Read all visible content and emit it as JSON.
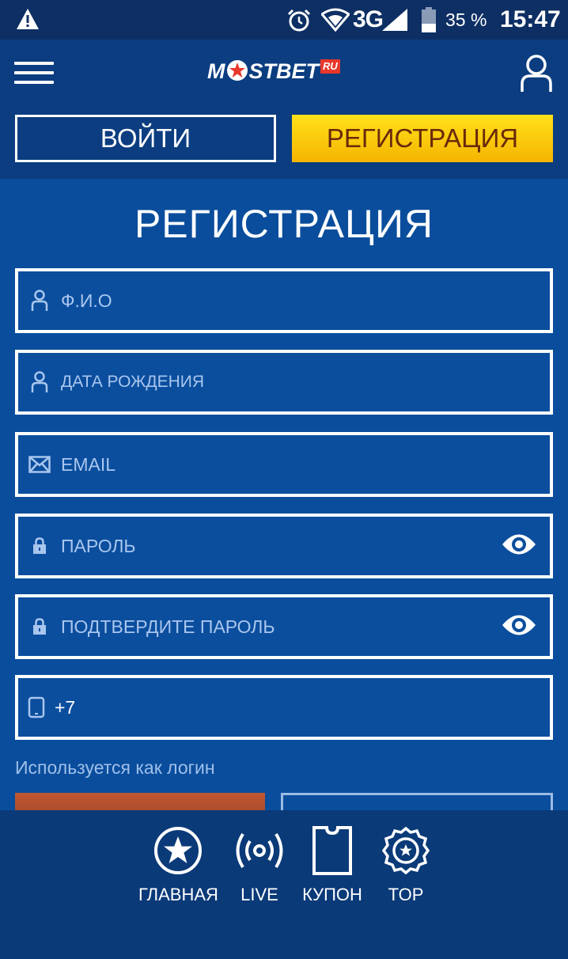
{
  "status_bar": {
    "network": "3G",
    "battery": "35 %",
    "time": "15:47"
  },
  "header": {
    "logo_text_1": "M",
    "logo_text_2": "STBET",
    "logo_badge": "RU",
    "login_label": "ВОЙТИ",
    "register_label": "РЕГИСТРАЦИЯ"
  },
  "form": {
    "title": "РЕГИСТРАЦИЯ",
    "fio_placeholder": "Ф.И.О",
    "birth_placeholder": "ДАТА РОЖДЕНИЯ",
    "email_placeholder": "EMAIL",
    "password_placeholder": "ПАРОЛЬ",
    "confirm_placeholder": "ПОДТВЕРДИТЕ ПАРОЛЬ",
    "phone_value": "+7",
    "phone_hint": "Используется как логин"
  },
  "bottom_nav": {
    "items": [
      {
        "label": "ГЛАВНАЯ",
        "icon": "star-circle-icon"
      },
      {
        "label": "LIVE",
        "icon": "broadcast-icon"
      },
      {
        "label": "КУПОН",
        "icon": "ticket-icon"
      },
      {
        "label": "TOP",
        "icon": "badge-star-icon"
      }
    ]
  },
  "colors": {
    "background": "#0a4d9c",
    "header": "#0b3d80",
    "register_button": "#ffd200",
    "register_text": "#6a2a0a"
  }
}
